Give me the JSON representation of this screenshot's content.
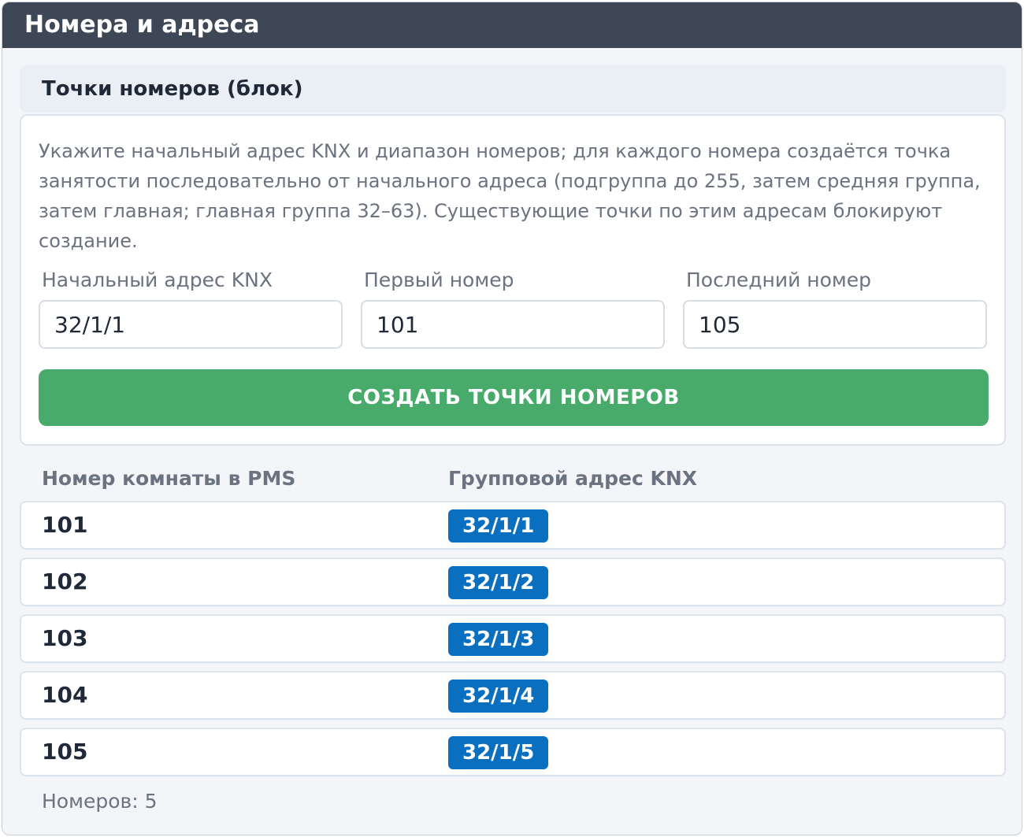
{
  "panel": {
    "title": "Номера и адреса"
  },
  "section": {
    "title": "Точки номеров (блок)"
  },
  "form": {
    "description": "Укажите начальный адрес KNX и диапазон номеров; для каждого номера создаётся точка занятости последовательно от начального адреса (подгруппа до 255, затем средняя группа, затем главная; главная группа 32–63). Существующие точки по этим адресам блокируют создание.",
    "start_address": {
      "label": "Начальный адрес KNX",
      "value": "32/1/1"
    },
    "first_room": {
      "label": "Первый номер",
      "value": "101"
    },
    "last_room": {
      "label": "Последний номер",
      "value": "105"
    },
    "create_button": "СОЗДАТЬ ТОЧКИ НОМЕРОВ"
  },
  "table": {
    "columns": [
      "Номер комнаты в PMS",
      "Групповой адрес KNX"
    ],
    "rows": [
      {
        "room": "101",
        "address": "32/1/1"
      },
      {
        "room": "102",
        "address": "32/1/2"
      },
      {
        "room": "103",
        "address": "32/1/3"
      },
      {
        "room": "104",
        "address": "32/1/4"
      },
      {
        "room": "105",
        "address": "32/1/5"
      }
    ]
  },
  "footer": {
    "count_text": "Номеров: 5"
  },
  "colors": {
    "header_bg": "#3d4756",
    "button_green": "#48ab6b",
    "badge_blue": "#0b6fbf"
  }
}
